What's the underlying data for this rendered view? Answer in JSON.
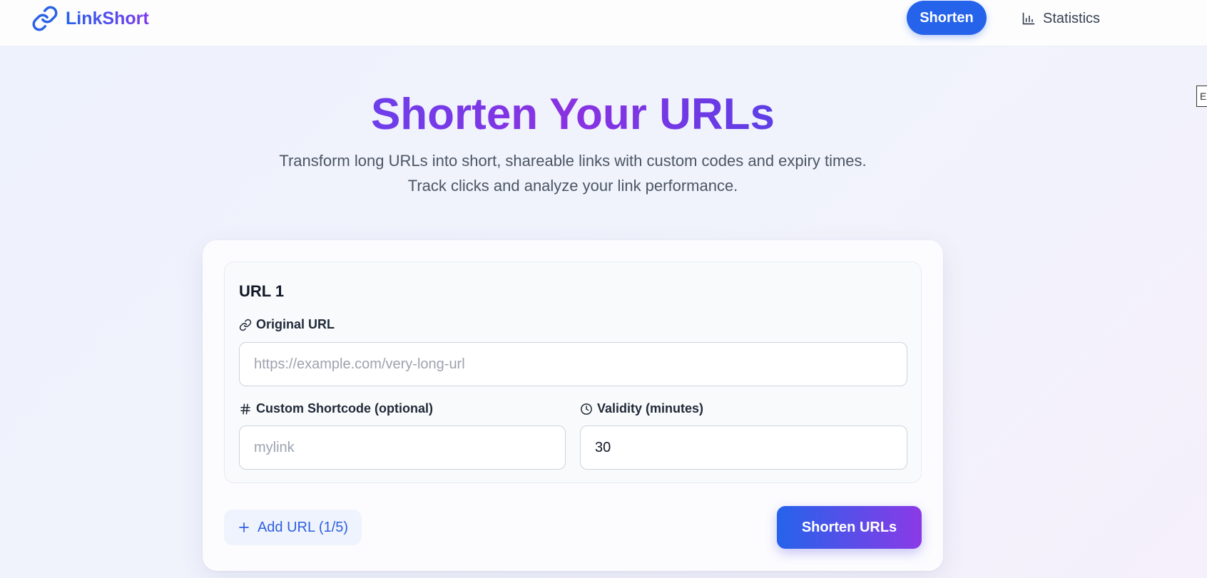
{
  "nav": {
    "brand": "LinkShort",
    "brand_icon": "link-icon",
    "shorten_label": "Shorten",
    "statistics_label": "Statistics",
    "statistics_icon": "bar-chart-icon",
    "edge_tab_label": "E"
  },
  "hero": {
    "title": "Shorten Your URLs",
    "subtitle_line1": "Transform long URLs into short, shareable links with custom codes and expiry times.",
    "subtitle_line2": "Track clicks and analyze your link performance."
  },
  "form": {
    "entries": [
      {
        "title": "URL 1",
        "original_url": {
          "label": "Original URL",
          "icon": "link-icon",
          "placeholder": "https://example.com/very-long-url",
          "value": ""
        },
        "shortcode": {
          "label": "Custom Shortcode (optional)",
          "icon": "hash-icon",
          "placeholder": "mylink",
          "value": ""
        },
        "validity": {
          "label": "Validity (minutes)",
          "icon": "clock-icon",
          "value": "30"
        }
      }
    ],
    "add_url_label": "Add URL (1/5)",
    "add_icon": "plus-icon",
    "submit_label": "Shorten URLs"
  },
  "colors": {
    "primary": "#2563eb",
    "accent": "#7c3aed",
    "text": "#1f2937",
    "muted": "#4b5563"
  }
}
